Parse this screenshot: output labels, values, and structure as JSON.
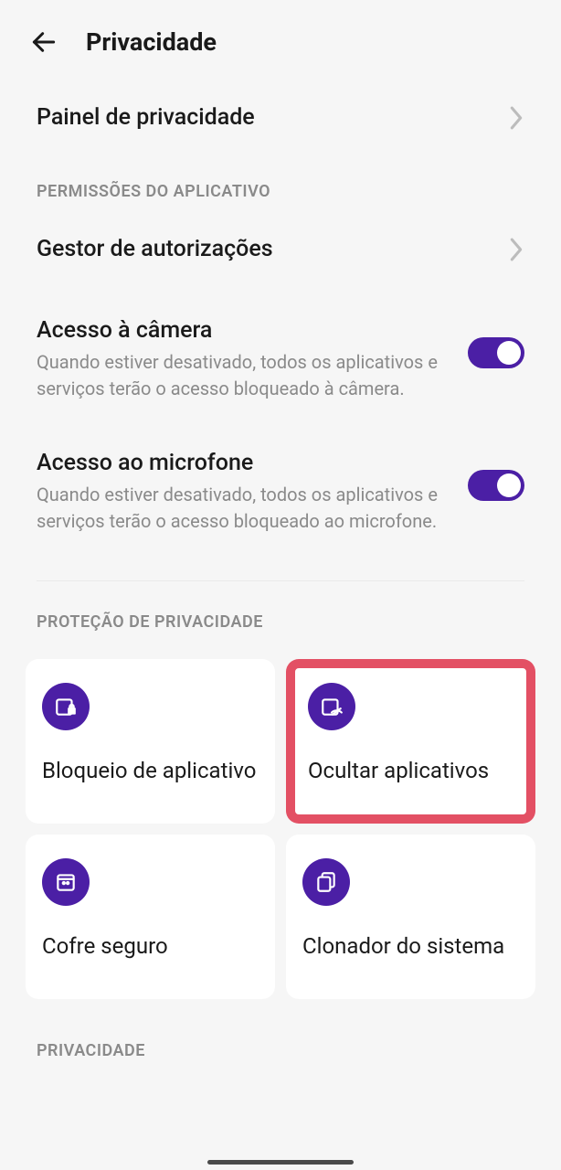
{
  "header": {
    "title": "Privacidade"
  },
  "rows": {
    "dashboard": "Painel de privacidade",
    "permissions_section": "PERMISSÕES DO APLICATIVO",
    "auth_manager": "Gestor de autorizações",
    "camera_title": "Acesso à câmera",
    "camera_desc": "Quando estiver desativado, todos os aplicativos e serviços terão o acesso bloqueado à câmera.",
    "mic_title": "Acesso ao microfone",
    "mic_desc": "Quando estiver desativado, todos os aplicativos e serviços terão o acesso bloqueado ao microfone.",
    "protection_section": "PROTEÇÃO DE PRIVACIDADE",
    "privacy_section": "PRIVACIDADE"
  },
  "cards": {
    "app_lock": "Bloqueio de aplicativo",
    "hide_apps": "Ocultar aplicativos",
    "safe": "Cofre seguro",
    "cloner": "Clonador do sistema"
  },
  "toggles": {
    "camera": true,
    "microphone": true
  },
  "accent_color": "#4b1fa5"
}
